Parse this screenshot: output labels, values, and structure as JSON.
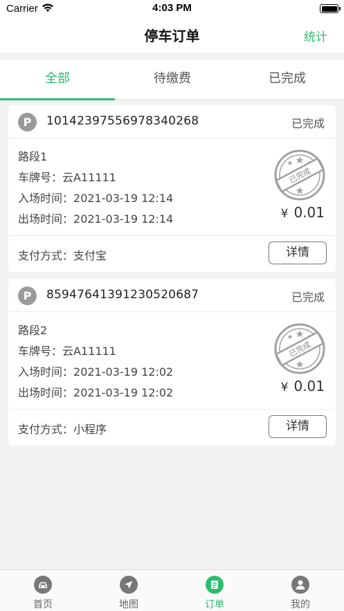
{
  "status_bar": {
    "carrier": "Carrier",
    "time": "4:03 PM"
  },
  "nav": {
    "title": "停车订单",
    "action": "统计"
  },
  "tabs": [
    {
      "label": "全部",
      "active": true
    },
    {
      "label": "待缴费",
      "active": false
    },
    {
      "label": "已完成",
      "active": false
    }
  ],
  "orders": [
    {
      "badge": "P",
      "order_no": "10142397556978340268",
      "status": "已完成",
      "road": "路段1",
      "plate_label": "车牌号：",
      "plate": "云A11111",
      "entry_label": "入场时间：",
      "entry_time": "2021-03-19 12:14",
      "exit_label": "出场时间：",
      "exit_time": "2021-03-19 12:14",
      "stamp_text": "已完成",
      "currency": "¥",
      "amount": "0.01",
      "pay_label": "支付方式：",
      "pay_method": "支付宝",
      "detail_label": "详情"
    },
    {
      "badge": "P",
      "order_no": "85947641391230520687",
      "status": "已完成",
      "road": "路段2",
      "plate_label": "车牌号：",
      "plate": "云A11111",
      "entry_label": "入场时间：",
      "entry_time": "2021-03-19 12:02",
      "exit_label": "出场时间：",
      "exit_time": "2021-03-19 12:02",
      "stamp_text": "已完成",
      "currency": "¥",
      "amount": "0.01",
      "pay_label": "支付方式：",
      "pay_method": "小程序",
      "detail_label": "详情"
    }
  ],
  "tab_bar": [
    {
      "label": "首页",
      "icon": "car-icon",
      "active": false
    },
    {
      "label": "地图",
      "icon": "navigation-icon",
      "active": false
    },
    {
      "label": "订单",
      "icon": "order-icon",
      "active": true
    },
    {
      "label": "我的",
      "icon": "user-icon",
      "active": false
    }
  ],
  "colors": {
    "accent": "#2bbd6e",
    "badge": "#9a9a9a",
    "stamp": "#9b9b9b"
  }
}
